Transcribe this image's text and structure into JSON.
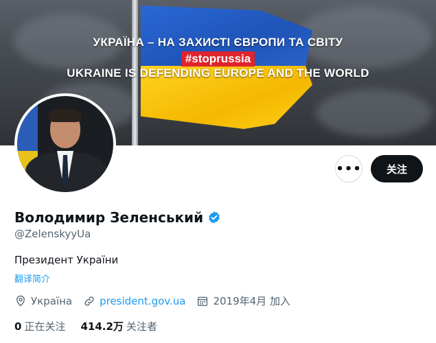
{
  "banner": {
    "line1": "УКРАЇНА – НА ЗАХИСТІ ЄВРОПИ ТА СВІТУ",
    "hashtag": "#stoprussia",
    "line3": "UKRAINE IS DEFENDING EUROPE AND THE WORLD"
  },
  "actions": {
    "more_label": "•••",
    "follow_label": "关注"
  },
  "profile": {
    "name": "Володимир Зеленський",
    "handle": "@ZelenskyyUa",
    "bio": "Президент України",
    "translate_label": "翻译简介",
    "location": "Україна",
    "website": "president.gov.ua",
    "joined": "2019年4月 加入"
  },
  "stats": {
    "following_count": "0",
    "following_label": "正在关注",
    "followers_count": "414.2万",
    "followers_label": "关注者"
  },
  "icons": {
    "location": "location-pin-icon",
    "link": "link-icon",
    "calendar": "calendar-icon",
    "verified": "verified-badge-icon"
  },
  "colors": {
    "accent": "#1d9bf0",
    "follow_button": "#0f1419",
    "hashtag_bg": "#e0242c",
    "flag_blue": "#1f54b8",
    "flag_yellow": "#f5b800"
  }
}
